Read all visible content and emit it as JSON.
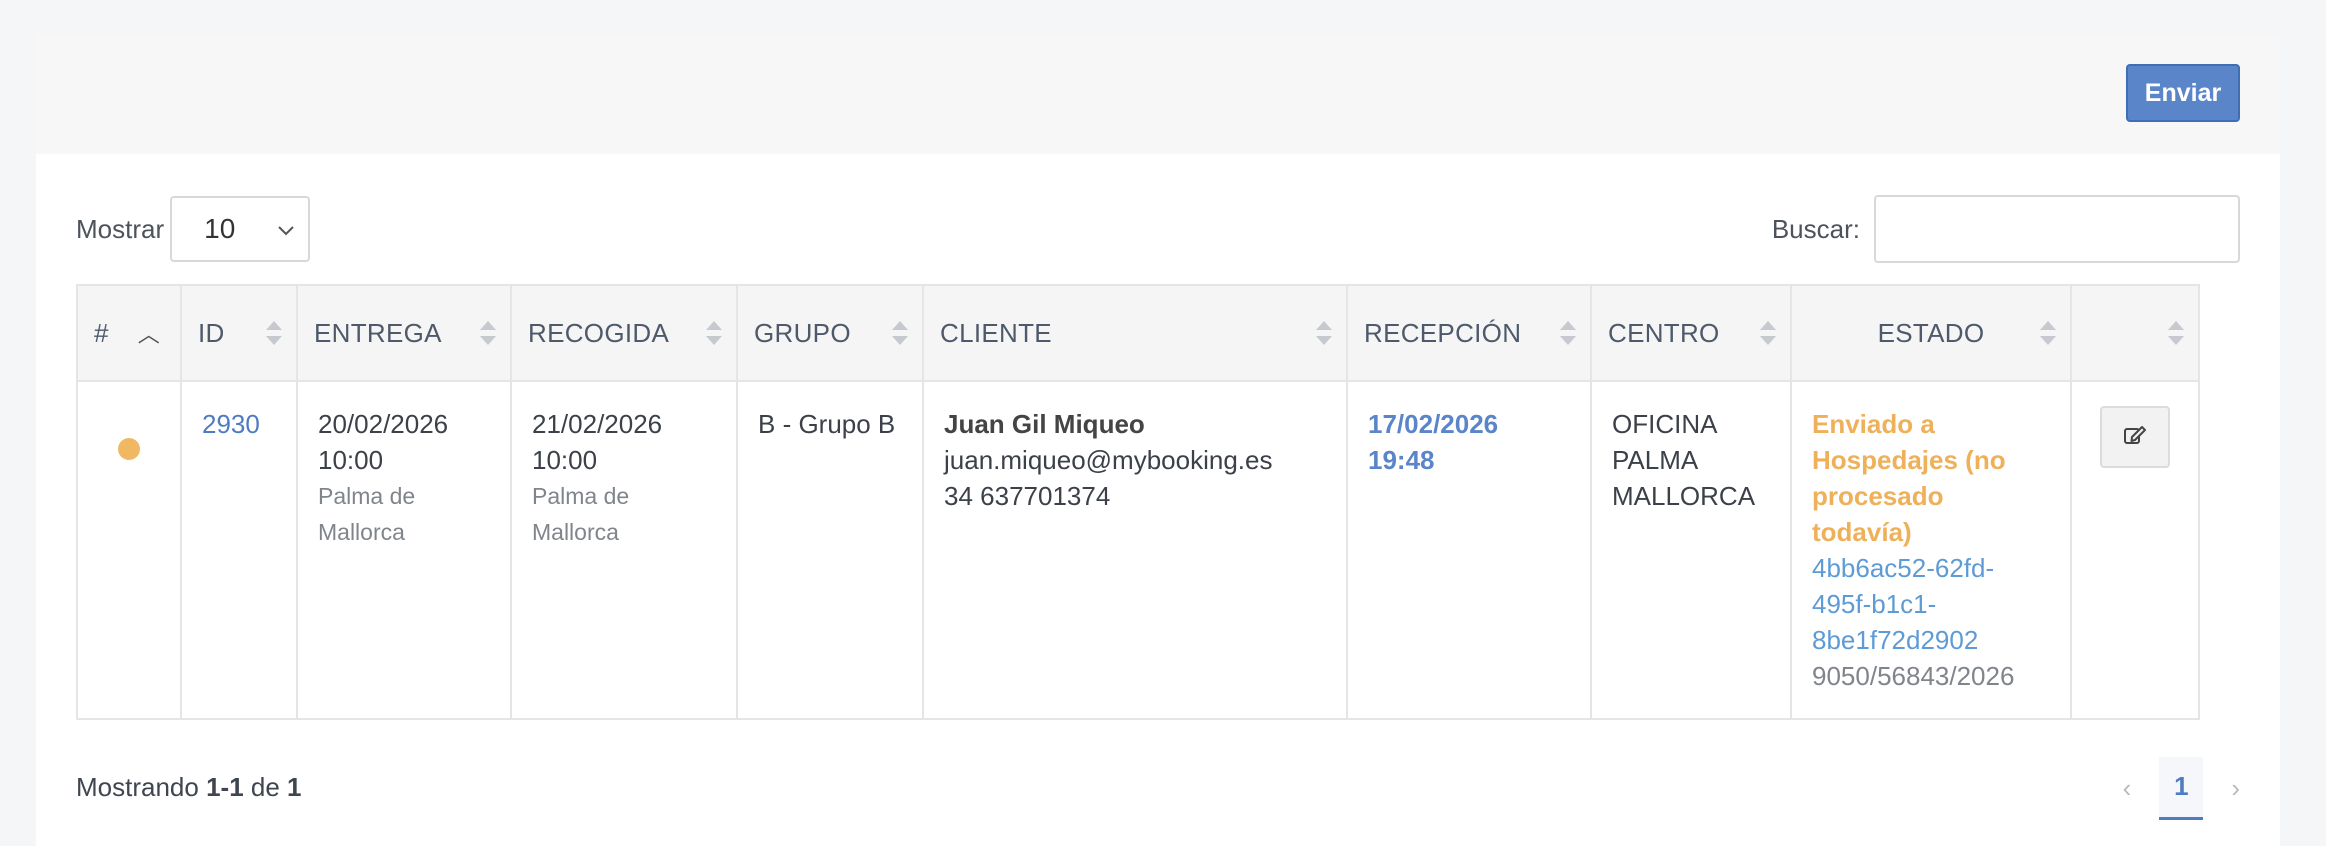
{
  "toolbar": {
    "send_label": "Enviar"
  },
  "length": {
    "label": "Mostrar",
    "value": "10"
  },
  "search": {
    "label": "Buscar:",
    "placeholder": ""
  },
  "table": {
    "headers": {
      "num": "#",
      "id": "ID",
      "entrega": "ENTREGA",
      "recogida": "RECOGIDA",
      "grupo": "GRUPO",
      "cliente": "CLIENTE",
      "recepcion": "RECEPCIÓN",
      "centro": "CENTRO",
      "estado": "ESTADO"
    },
    "rows": [
      {
        "status_color": "#f0b862",
        "id": "2930",
        "entrega_date": "20/02/2026",
        "entrega_time": "10:00",
        "entrega_loc_1": "Palma de",
        "entrega_loc_2": "Mallorca",
        "recogida_date": "21/02/2026",
        "recogida_time": "10:00",
        "recogida_loc_1": "Palma de",
        "recogida_loc_2": "Mallorca",
        "grupo": "B - Grupo B",
        "cliente_name": "Juan Gil Miqueo",
        "cliente_email": "juan.miqueo@mybooking.es",
        "cliente_phone": "34 637701374",
        "recepcion_date": "17/02/2026",
        "recepcion_time": "19:48",
        "centro_1": "OFICINA",
        "centro_2": "PALMA",
        "centro_3": "MALLORCA",
        "estado_1": "Enviado a",
        "estado_2": "Hospedajes (no",
        "estado_3": "procesado",
        "estado_4": "todavía)",
        "uuid_1": "4bb6ac52-62fd-",
        "uuid_2": "495f-b1c1-",
        "uuid_3": "8be1f72d2902",
        "ref": "9050/56843/2026",
        "action_icon": "edit-icon"
      }
    ]
  },
  "footer": {
    "prefix": "Mostrando ",
    "range": "1-1",
    "middle": " de ",
    "total": "1"
  },
  "pagination": {
    "current": "1"
  },
  "colors": {
    "accent": "#5a86c9",
    "warning": "#efb05a",
    "link": "#4f7cc1"
  }
}
